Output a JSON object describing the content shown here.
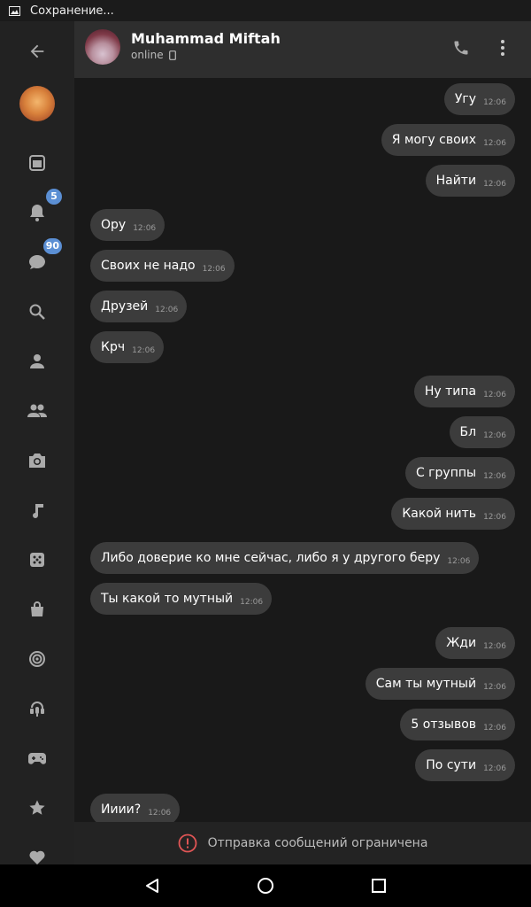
{
  "status_bar": {
    "text": "Сохранение...",
    "icon": "image-icon"
  },
  "sidebar": {
    "items": [
      {
        "name": "back-icon"
      },
      {
        "name": "newsfeed-icon"
      },
      {
        "name": "notifications-icon",
        "badge": "5"
      },
      {
        "name": "messages-icon",
        "badge": "90"
      },
      {
        "name": "search-icon"
      },
      {
        "name": "profile-icon"
      },
      {
        "name": "friends-icon"
      },
      {
        "name": "camera-icon"
      },
      {
        "name": "music-icon"
      },
      {
        "name": "games-icon"
      },
      {
        "name": "shop-icon"
      },
      {
        "name": "target-icon"
      },
      {
        "name": "podcasts-icon"
      },
      {
        "name": "gamepad-icon"
      },
      {
        "name": "star-icon"
      },
      {
        "name": "heart-icon"
      }
    ]
  },
  "header": {
    "name": "Muhammad Miftah",
    "status": "online",
    "status_icon": "mobile-icon",
    "call_icon": "phone-icon",
    "more_icon": "more-vertical-icon"
  },
  "messages": [
    {
      "dir": "out",
      "text": "Угу",
      "time": "12:06"
    },
    {
      "dir": "out",
      "text": "Я могу своих",
      "time": "12:06"
    },
    {
      "dir": "out",
      "text": "Найти",
      "time": "12:06"
    },
    {
      "dir": "in",
      "text": "Ору",
      "time": "12:06"
    },
    {
      "dir": "in",
      "text": "Своих не надо",
      "time": "12:06"
    },
    {
      "dir": "in",
      "text": "Друзей",
      "time": "12:06"
    },
    {
      "dir": "in",
      "text": "Крч",
      "time": "12:06"
    },
    {
      "dir": "out",
      "text": "Ну типа",
      "time": "12:06"
    },
    {
      "dir": "out",
      "text": "Бл",
      "time": "12:06"
    },
    {
      "dir": "out",
      "text": "С группы",
      "time": "12:06"
    },
    {
      "dir": "out",
      "text": "Какой нить",
      "time": "12:06"
    },
    {
      "dir": "in",
      "text": "Либо доверие ко мне сейчас, либо я у другого беру",
      "time": "12:06"
    },
    {
      "dir": "in",
      "text": "Ты какой то мутный",
      "time": "12:06"
    },
    {
      "dir": "out",
      "text": "Жди",
      "time": "12:06"
    },
    {
      "dir": "out",
      "text": "Сам ты мутный",
      "time": "12:06"
    },
    {
      "dir": "out",
      "text": "5 отзывов",
      "time": "12:06"
    },
    {
      "dir": "out",
      "text": "По сути",
      "time": "12:06"
    },
    {
      "dir": "in",
      "text": "Ииии?",
      "time": "12:06"
    }
  ],
  "composer": {
    "text": "Отправка сообщений ограничена",
    "icon": "error-icon"
  },
  "nav_bar": {
    "back": "back-triangle-icon",
    "home": "home-circle-icon",
    "recents": "recents-square-icon"
  },
  "colors": {
    "bubble": "#3c3c3c",
    "chat_bg": "#191919",
    "header_bg": "#2e2e2e",
    "badge": "#5b8fd4",
    "warning": "#e05555"
  }
}
